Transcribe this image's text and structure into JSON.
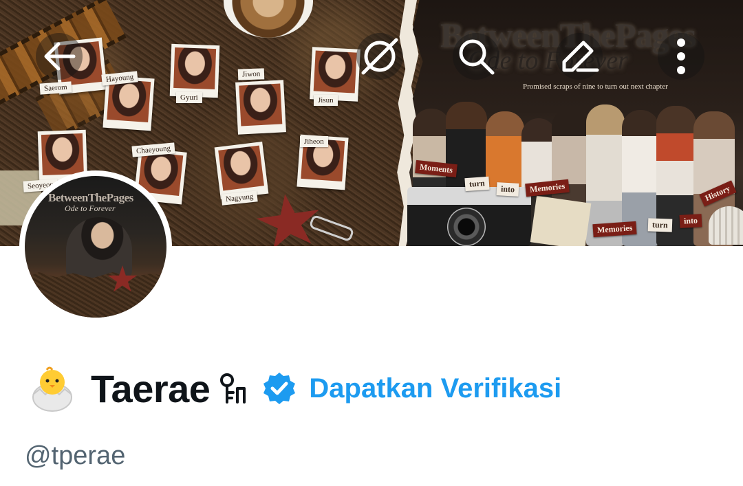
{
  "header": {
    "banner": {
      "title": "BetweenThePages",
      "script": "Ode to Forever",
      "subtitle": "Promised scraps of nine to turn out next chapter",
      "member_tags": [
        "Saerom",
        "Hayoung",
        "Gyuri",
        "Jiwon",
        "Jisun",
        "Seoyeon",
        "Chaeyoung",
        "Nagyung",
        "Jiheon"
      ],
      "word_labels": [
        "Moments",
        "turn",
        "into",
        "Memories",
        "History",
        "Memories",
        "turn",
        "into"
      ]
    },
    "buttons": {
      "back": "back-arrow-icon",
      "grok": "grok-icon",
      "search": "search-icon",
      "edit": "compose-icon",
      "more": "more-vertical-icon"
    }
  },
  "avatar": {
    "overlay_title": "BetweenThePages",
    "overlay_script": "Ode to Forever"
  },
  "profile": {
    "emoji": "🐣",
    "display_name": "Taerae",
    "name_icon": "key-person-icon",
    "verified_icon": "verified-badge-icon",
    "verify_cta": "Dapatkan Verifikasi",
    "handle": "@tperae"
  },
  "colors": {
    "text_primary": "#0f1419",
    "text_secondary": "#536471",
    "accent": "#1d9bf0"
  }
}
